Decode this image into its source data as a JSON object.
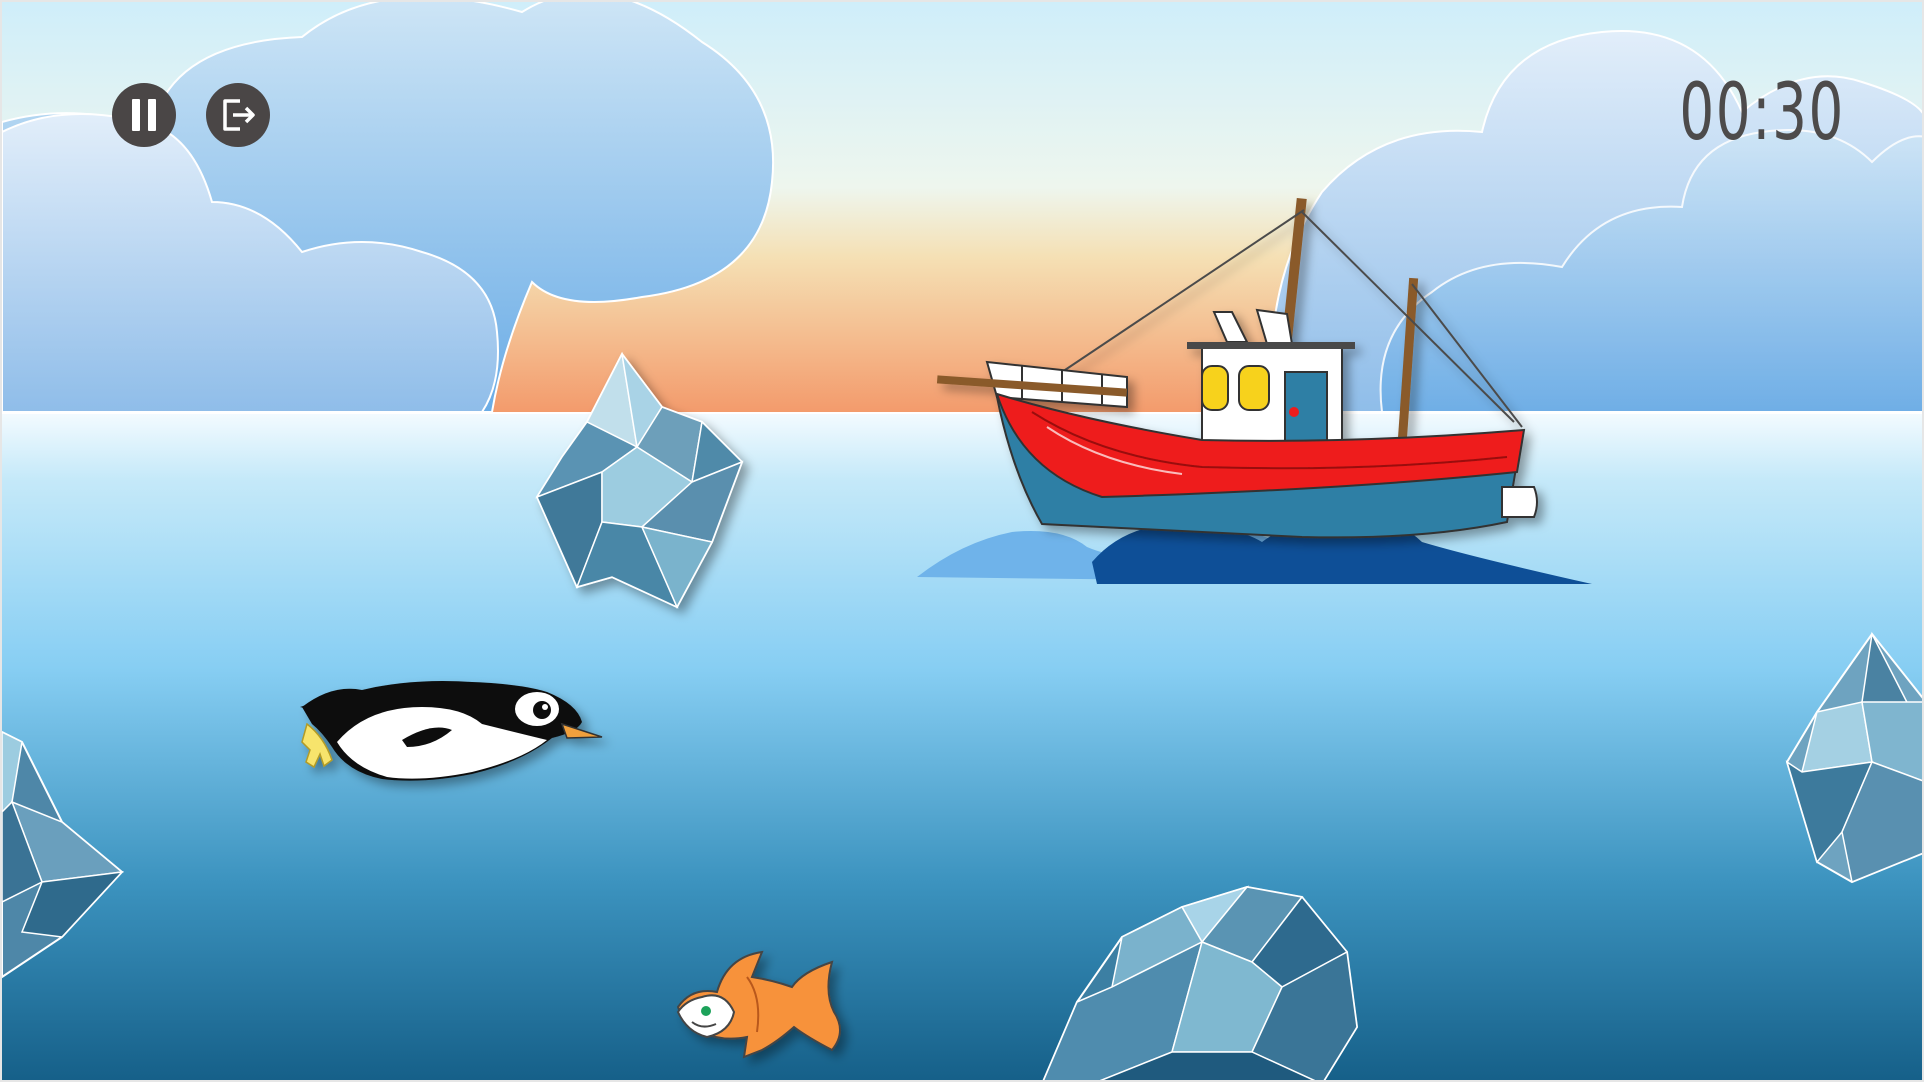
{
  "hud": {
    "timer": "00:30",
    "pause_icon": "pause-icon",
    "exit_icon": "exit-icon"
  },
  "colors": {
    "sky_top": "#cfeefa",
    "sunset": "#f39a6b",
    "sea_top": "#eaf8fe",
    "sea_mid": "#87cef3",
    "sea_bottom": "#1a6a92",
    "boat_hull_red": "#ee1c1c",
    "boat_hull_blue": "#2f7fa5",
    "hud_button": "#4a4646"
  }
}
